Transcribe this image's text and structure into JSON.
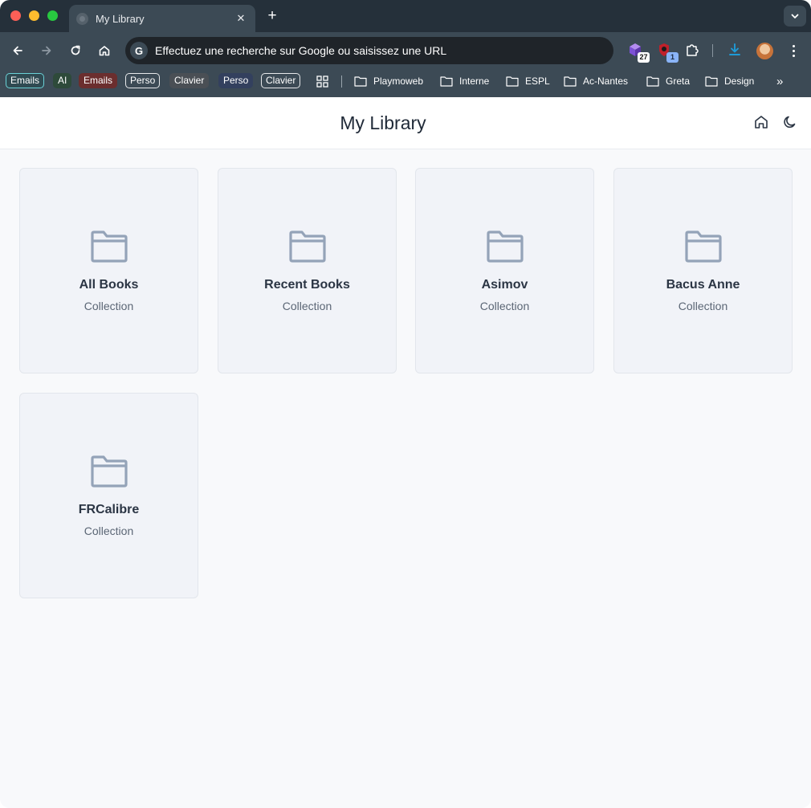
{
  "browser": {
    "tab": {
      "title": "My Library",
      "close": "✕"
    },
    "new_tab": "+",
    "omnibox": {
      "badge": "G",
      "placeholder": "Effectuez une recherche sur Google ou saisissez une URL"
    },
    "extensions": [
      {
        "name": "cube-extension-icon",
        "badge": "27",
        "badge_bg": "#ffffff",
        "badge_color": "#111111"
      },
      {
        "name": "shield-extension-icon",
        "badge": "1",
        "badge_bg": "#8ab4f8",
        "badge_color": "#1a2a40"
      }
    ],
    "bookmark_chips": [
      {
        "label": "Emails",
        "bg": "#2f4a52",
        "color": "#ffffff",
        "border": "#6ad1d6"
      },
      {
        "label": "AI",
        "bg": "#2e4a3a",
        "color": "#ffffff",
        "border": "#2e4a3a"
      },
      {
        "label": "Emails",
        "bg": "#6b2e2e",
        "color": "#ffffff",
        "border": "#6b2e2e"
      },
      {
        "label": "Perso",
        "bg": "#3c4a55",
        "color": "#ffffff",
        "border": "#e6e8ea"
      },
      {
        "label": "Clavier",
        "bg": "#4a4f55",
        "color": "#ffffff",
        "border": "#4a4f55"
      },
      {
        "label": "Perso",
        "bg": "#33405e",
        "color": "#ffffff",
        "border": "#33405e"
      },
      {
        "label": "Clavier",
        "bg": "#3c4a55",
        "color": "#ffffff",
        "border": "#e6e8ea"
      }
    ],
    "bookmark_folders": [
      "Playmoweb",
      "Interne",
      "ESPL",
      "Ac-Nantes",
      "Greta",
      "Design"
    ],
    "overflow": "»"
  },
  "app": {
    "title": "My Library",
    "collections": [
      {
        "name": "All Books",
        "type": "Collection"
      },
      {
        "name": "Recent Books",
        "type": "Collection"
      },
      {
        "name": "Asimov",
        "type": "Collection"
      },
      {
        "name": "Bacus Anne",
        "type": "Collection"
      },
      {
        "name": "FRCalibre",
        "type": "Collection"
      }
    ]
  },
  "colors": {
    "folder_icon": "#94a3b8",
    "card_bg": "#f1f3f8",
    "page_bg": "#f8f9fb"
  }
}
